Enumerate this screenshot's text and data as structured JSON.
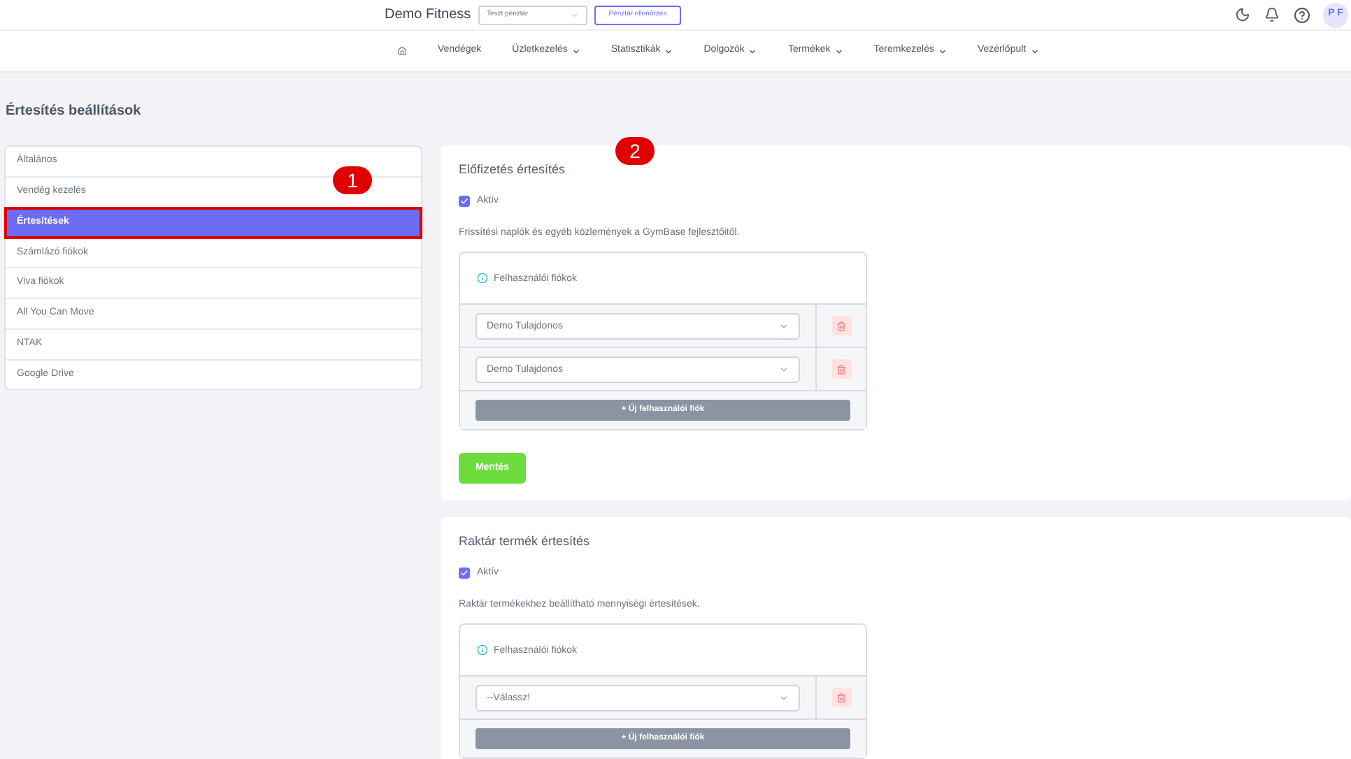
{
  "brand": "Demo Fitness",
  "register_select": {
    "value": "Teszt pénztár"
  },
  "register_check_button": "Pénztár ellenőrzés",
  "avatar": "P F",
  "nav": [
    {
      "label": "Vendégek",
      "dropdown": false
    },
    {
      "label": "Üzletkezelés",
      "dropdown": true
    },
    {
      "label": "Statisztikák",
      "dropdown": true
    },
    {
      "label": "Dolgozók",
      "dropdown": true
    },
    {
      "label": "Termékek",
      "dropdown": true
    },
    {
      "label": "Teremkezelés",
      "dropdown": true
    },
    {
      "label": "Vezérlőpult",
      "dropdown": true
    }
  ],
  "page_title": "Értesítés beállítások",
  "sidebar": {
    "items": [
      {
        "label": "Általános",
        "selected": false
      },
      {
        "label": "Vendég kezelés",
        "selected": false
      },
      {
        "label": "Értesítések",
        "selected": true
      },
      {
        "label": "Számlázó fiókok",
        "selected": false
      },
      {
        "label": "Viva fiókok",
        "selected": false
      },
      {
        "label": "All You Can Move",
        "selected": false
      },
      {
        "label": "NTAK",
        "selected": false
      },
      {
        "label": "Google Drive",
        "selected": false
      }
    ]
  },
  "callouts": [
    "1",
    "2"
  ],
  "sections": [
    {
      "title": "Előfizetés értesítés",
      "active": {
        "label": "Aktív",
        "checked": true
      },
      "description": "Frissítési naplók és egyéb közlemények a GymBase fejlesztőitől.",
      "accounts_heading": "Felhasználói fiókok",
      "accounts": [
        {
          "value": "Demo Tulajdonos"
        },
        {
          "value": "Demo Tulajdonos"
        }
      ],
      "add_button": "+ Új felhasználói fiók",
      "save_button": "Mentés"
    },
    {
      "title": "Raktár termék értesítés",
      "active": {
        "label": "Aktív",
        "checked": true
      },
      "description": "Raktár termékekhez beállítható mennyiségi értesítések.",
      "accounts_heading": "Felhasználói fiókok",
      "accounts": [
        {
          "value": "--Válassz!"
        }
      ],
      "add_button": "+ Új felhasználói fiók"
    }
  ]
}
